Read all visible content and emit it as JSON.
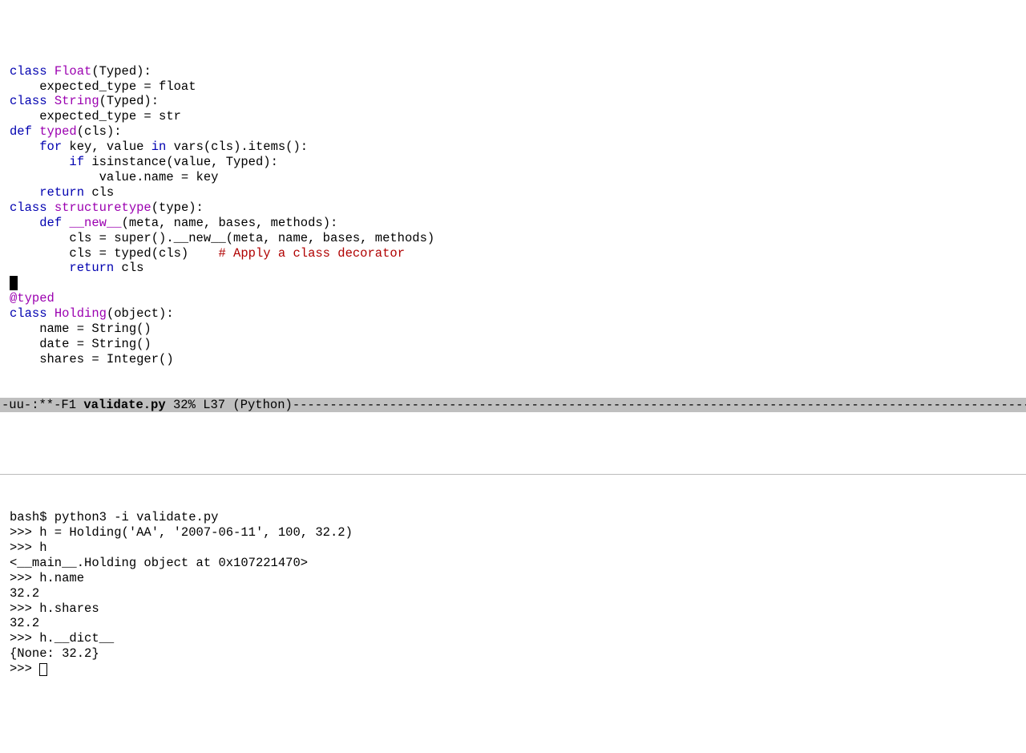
{
  "editor": {
    "lines": [
      [
        {
          "t": "class ",
          "c": "kw"
        },
        {
          "t": "Float",
          "c": "name"
        },
        {
          "t": "(Typed):",
          "c": ""
        }
      ],
      [
        {
          "t": "    expected_type = float",
          "c": ""
        }
      ],
      [
        {
          "t": "",
          "c": ""
        }
      ],
      [
        {
          "t": "class ",
          "c": "kw"
        },
        {
          "t": "String",
          "c": "name"
        },
        {
          "t": "(Typed):",
          "c": ""
        }
      ],
      [
        {
          "t": "    expected_type = str",
          "c": ""
        }
      ],
      [
        {
          "t": "",
          "c": ""
        }
      ],
      [
        {
          "t": "def ",
          "c": "kw"
        },
        {
          "t": "typed",
          "c": "name"
        },
        {
          "t": "(cls):",
          "c": ""
        }
      ],
      [
        {
          "t": "    ",
          "c": ""
        },
        {
          "t": "for",
          "c": "kw"
        },
        {
          "t": " key, value ",
          "c": ""
        },
        {
          "t": "in",
          "c": "kw"
        },
        {
          "t": " vars(cls).items():",
          "c": ""
        }
      ],
      [
        {
          "t": "        ",
          "c": ""
        },
        {
          "t": "if",
          "c": "kw"
        },
        {
          "t": " isinstance(value, Typed):",
          "c": ""
        }
      ],
      [
        {
          "t": "            value.name = key",
          "c": ""
        }
      ],
      [
        {
          "t": "    ",
          "c": ""
        },
        {
          "t": "return",
          "c": "kw"
        },
        {
          "t": " cls",
          "c": ""
        }
      ],
      [
        {
          "t": "",
          "c": ""
        }
      ],
      [
        {
          "t": "class ",
          "c": "kw"
        },
        {
          "t": "structuretype",
          "c": "name"
        },
        {
          "t": "(type):",
          "c": ""
        }
      ],
      [
        {
          "t": "    ",
          "c": ""
        },
        {
          "t": "def ",
          "c": "kw"
        },
        {
          "t": "__new__",
          "c": "name"
        },
        {
          "t": "(meta, name, bases, methods):",
          "c": ""
        }
      ],
      [
        {
          "t": "        cls = super().__new__(meta, name, bases, methods)",
          "c": ""
        }
      ],
      [
        {
          "t": "        cls = typed(cls)    ",
          "c": ""
        },
        {
          "t": "# Apply a class decorator",
          "c": "cmt"
        }
      ],
      [
        {
          "t": "        ",
          "c": ""
        },
        {
          "t": "return",
          "c": "kw"
        },
        {
          "t": " cls",
          "c": ""
        }
      ],
      [
        {
          "t": "",
          "c": "",
          "cursor": true
        }
      ],
      [
        {
          "t": "@typed",
          "c": "name"
        }
      ],
      [
        {
          "t": "class ",
          "c": "kw"
        },
        {
          "t": "Holding",
          "c": "name"
        },
        {
          "t": "(object):",
          "c": ""
        }
      ],
      [
        {
          "t": "    name = String()",
          "c": ""
        }
      ],
      [
        {
          "t": "    date = String()",
          "c": ""
        }
      ],
      [
        {
          "t": "    shares = Integer()",
          "c": ""
        }
      ]
    ]
  },
  "modeline": {
    "left": "-uu-:**-F1",
    "filename": "validate.py",
    "percent": "32%",
    "line": "L37",
    "mode": "(Python)",
    "fill": "----------------------------------------------------------------------------------------------------------------"
  },
  "terminal": {
    "lines": [
      "bash$ python3 -i validate.py",
      ">>> h = Holding('AA', '2007-06-11', 100, 32.2)",
      ">>> h",
      "<__main__.Holding object at 0x107221470>",
      ">>> h.name",
      "32.2",
      ">>> h.shares",
      "32.2",
      ">>> h.__dict__",
      "{None: 32.2}"
    ],
    "prompt": ">>> "
  }
}
